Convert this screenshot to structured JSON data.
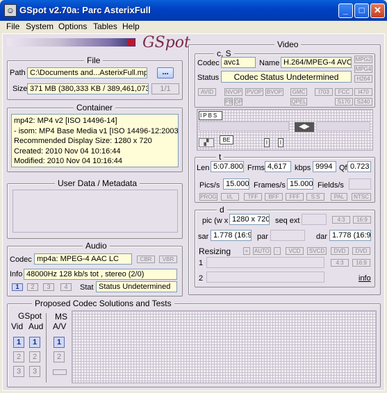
{
  "window": {
    "title": "GSpot v2.70a: Parc AsterixFull",
    "logo_text": "GSpot"
  },
  "menu": [
    "File",
    "System",
    "Options",
    "Tables",
    "Help"
  ],
  "file": {
    "group_title": "File",
    "path_label": "Path",
    "path_value": "C:\\Documents and...AsterixFull.mp4",
    "browse_label": "...",
    "size_label": "Size",
    "size_value": "371 MB (380,333 KB / 389,461,073",
    "page_label": "1/1"
  },
  "container": {
    "group_title": "Container",
    "lines": [
      "mp42: MP4 v2 [ISO 14496-14]",
      "- isom: MP4  Base Media v1 [ISO 14496-12:2003]",
      "Recommended Display Size: 1280 x 720",
      "Created:    2010 Nov 04    10:16:44",
      "Modified:   2010 Nov 04    10:16:44"
    ]
  },
  "userdata": {
    "group_title": "User Data / Metadata"
  },
  "audio": {
    "group_title": "Audio",
    "codec_label": "Codec",
    "codec_value": "mp4a: MPEG-4 AAC LC",
    "cbr": "CBR",
    "vbr": "VBR",
    "info_label": "Info",
    "info_value": "48000Hz  128 kb/s tot , stereo (2/0)",
    "tabs": [
      "1",
      "2",
      "3",
      "4"
    ],
    "stat_label": "Stat",
    "stat_value": "Status Undetermined"
  },
  "video": {
    "group_title": "Video",
    "cs_title": "c, S",
    "codec_label": "Codec",
    "codec_value": "avc1",
    "name_label": "Name",
    "name_value": "H.264/MPEG-4 AVC",
    "side_buttons": [
      "MPG2",
      "MPG4",
      "H264"
    ],
    "status_label": "Status",
    "status_value": "Codec Status Undetermined",
    "tag_row1": [
      "AVID",
      "NVOP",
      "PVOP",
      "BVOP",
      "GMC",
      "I703",
      "FCC",
      "I470"
    ],
    "tag_row2": [
      "PB",
      "DP",
      "QPEL",
      "S170",
      "S240"
    ],
    "frame_labels": [
      "I",
      "P",
      "B",
      "S",
      "B",
      "E",
      "I",
      "I"
    ],
    "t_title": "t",
    "len_label": "Len",
    "len_value": "5:07.800",
    "frms_label": "Frms",
    "frms_value": "4,617",
    "kbps_label": "kbps",
    "kbps_value": "9994",
    "qf_label": "Qf",
    "qf_value": "0.723",
    "pics_label": "Pics/s",
    "pics_value": "15.000",
    "frames_label": "Frames/s",
    "frames_value": "15.000",
    "fields_label": "Fields/s",
    "tag_row3": [
      "PROG",
      "I/L",
      "TFF",
      "BFF",
      "FFF",
      "S:S",
      "PAL",
      "NTSC"
    ],
    "d_title": "d",
    "pic_label": "pic (w x",
    "pic_value": "1280 x 720",
    "seqext_label": "seq ext",
    "ar_buttons": [
      "4:3",
      "16:9"
    ],
    "sar_label": "sar",
    "sar_value": "1.778 (16:9)",
    "par_label": "par",
    "dar_label": "dar",
    "dar_value": "1.778 (16:9)",
    "resizing_label": "Resizing",
    "resize_buttons": [
      "+",
      "AUTO",
      "-",
      "VCD",
      "SVCD",
      "DVD",
      "DVD"
    ],
    "resize_row1_label": "1",
    "resize_row2_label": "2",
    "ar_buttons2": [
      "4:3",
      "16:9"
    ],
    "info_link": "info"
  },
  "proposed": {
    "group_title": "Proposed Codec Solutions and Tests",
    "gspot_label": "GSpot",
    "vid_label": "Vid",
    "aud_label": "Aud",
    "ms_label": "MS",
    "av_label": "A/V",
    "numbers": [
      "1",
      "2",
      "3"
    ]
  },
  "colors": {
    "titlebar": "#0054e3",
    "pane": "#e6e0ea",
    "highlight": "#fffcd8"
  }
}
